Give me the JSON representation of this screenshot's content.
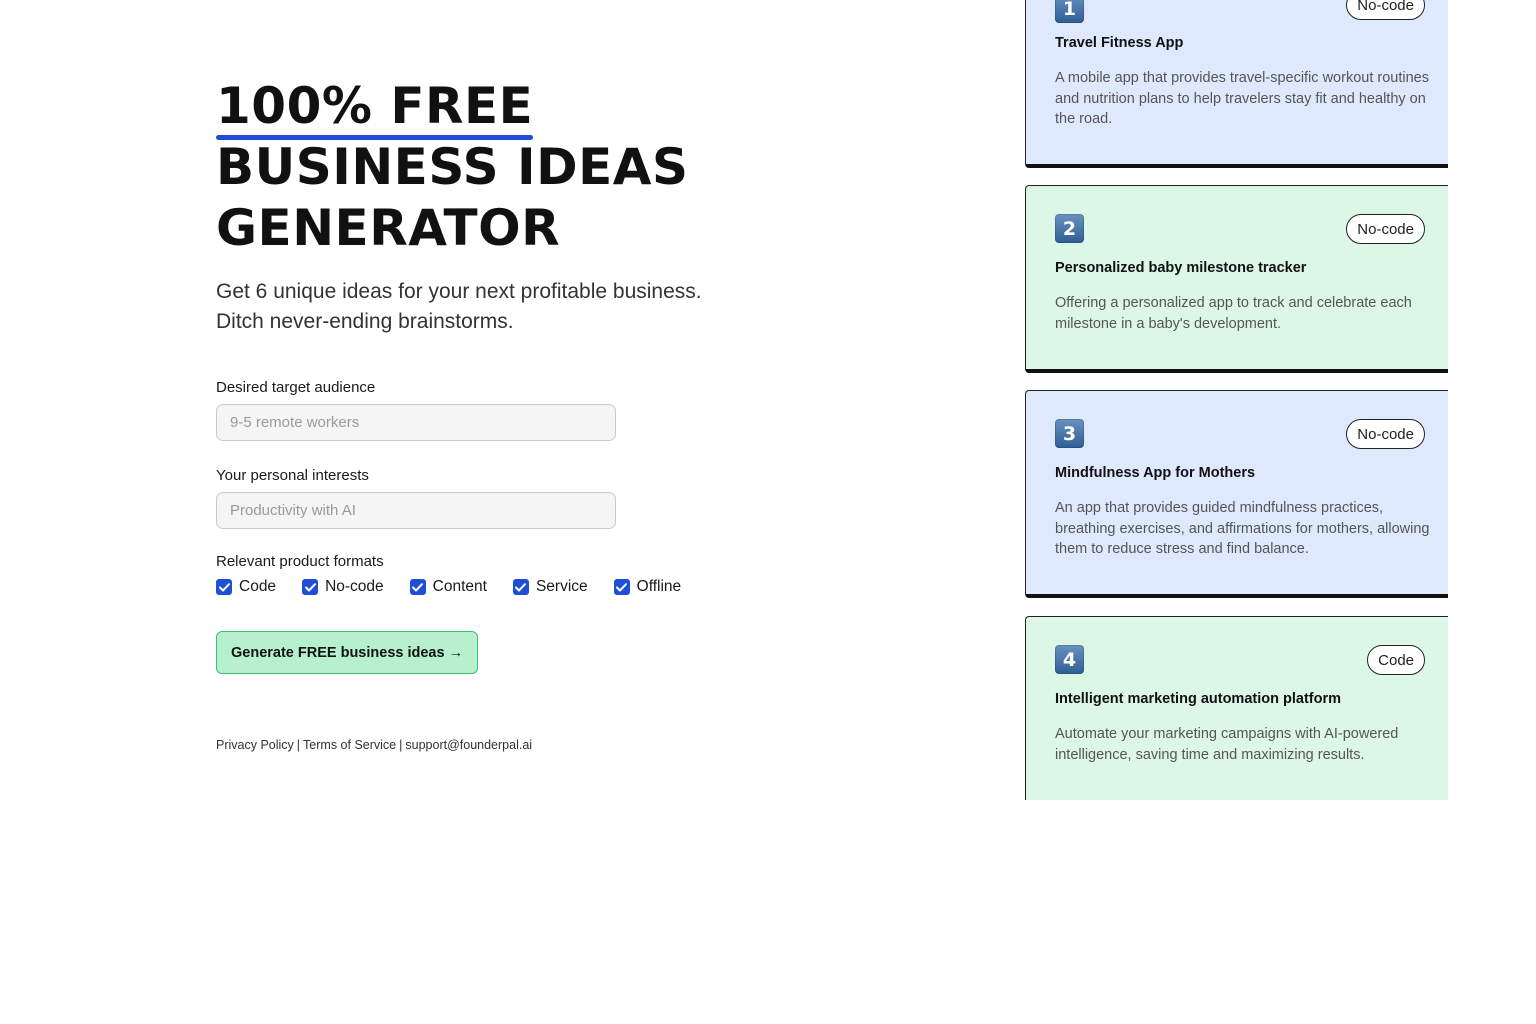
{
  "hero": {
    "headline_line1": "100% FREE",
    "headline_line2": "BUSINESS IDEAS",
    "headline_line3": "GENERATOR",
    "subtitle_line1": "Get 6 unique ideas for your next profitable business.",
    "subtitle_line2": "Ditch never-ending brainstorms.",
    "accent_color": "#1f4fd6"
  },
  "form": {
    "audience": {
      "label": "Desired target audience",
      "placeholder": "9-5 remote workers",
      "value": ""
    },
    "interests": {
      "label": "Your personal interests",
      "placeholder": "Productivity with AI",
      "value": ""
    },
    "formats": {
      "label": "Relevant product formats",
      "options": [
        {
          "label": "Code",
          "checked": true
        },
        {
          "label": "No-code",
          "checked": true
        },
        {
          "label": "Content",
          "checked": true
        },
        {
          "label": "Service",
          "checked": true
        },
        {
          "label": "Offline",
          "checked": true
        }
      ]
    },
    "submit_label": "Generate FREE business ideas →",
    "submit_color": "#b7f0cd"
  },
  "footer": {
    "privacy": "Privacy Policy",
    "terms": "Terms of Service",
    "email": "support@founderpal.ai",
    "separator": "|"
  },
  "ideas": [
    {
      "number": "1",
      "tag": "No-code",
      "title": "Travel Fitness App",
      "description": "A mobile app that provides travel-specific workout routines and nutrition plans to help travelers stay fit and healthy on the road.",
      "color": "#dfe9fd"
    },
    {
      "number": "2",
      "tag": "No-code",
      "title": "Personalized baby milestone tracker",
      "description": "Offering a personalized app to track and celebrate each milestone in a baby's development.",
      "color": "#dcf7e5"
    },
    {
      "number": "3",
      "tag": "No-code",
      "title": "Mindfulness App for Mothers",
      "description": "An app that provides guided mindfulness practices, breathing exercises, and affirmations for mothers, allowing them to reduce stress and find balance.",
      "color": "#dfe9fd"
    },
    {
      "number": "4",
      "tag": "Code",
      "title": "Intelligent marketing automation platform",
      "description": "Automate your marketing campaigns with AI-powered intelligence, saving time and maximizing results.",
      "color": "#dcf7e5"
    }
  ]
}
